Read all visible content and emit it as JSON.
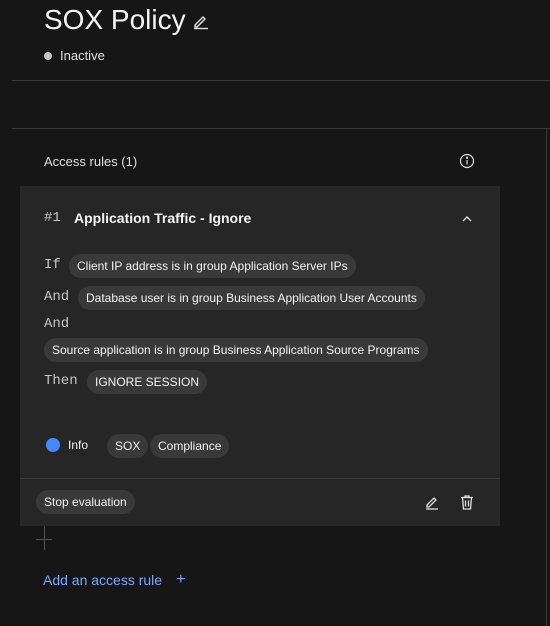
{
  "policy": {
    "title": "SOX Policy",
    "status": "Inactive"
  },
  "access_rules": {
    "section_title": "Access rules (1)",
    "rule": {
      "number": "#1",
      "name": "Application Traffic - Ignore",
      "conditions": [
        {
          "keyword": "If",
          "value": "Client IP address is in group Application Server IPs"
        },
        {
          "keyword": "And",
          "value": "Database user is in group Business Application User Accounts"
        },
        {
          "keyword": "And",
          "value": "Source application is in group Business Application Source Programs"
        }
      ],
      "action": {
        "keyword": "Then",
        "value": "IGNORE SESSION"
      },
      "severity": {
        "label": "Info",
        "color": "#4589ff"
      },
      "tags": [
        "SOX",
        "Compliance"
      ],
      "footer_tag": "Stop evaluation"
    },
    "add_label": "Add an access rule",
    "add_symbol": "+"
  },
  "icons": [
    "edit-icon",
    "info-icon",
    "chevron-up-icon",
    "trash-icon",
    "add-icon"
  ]
}
